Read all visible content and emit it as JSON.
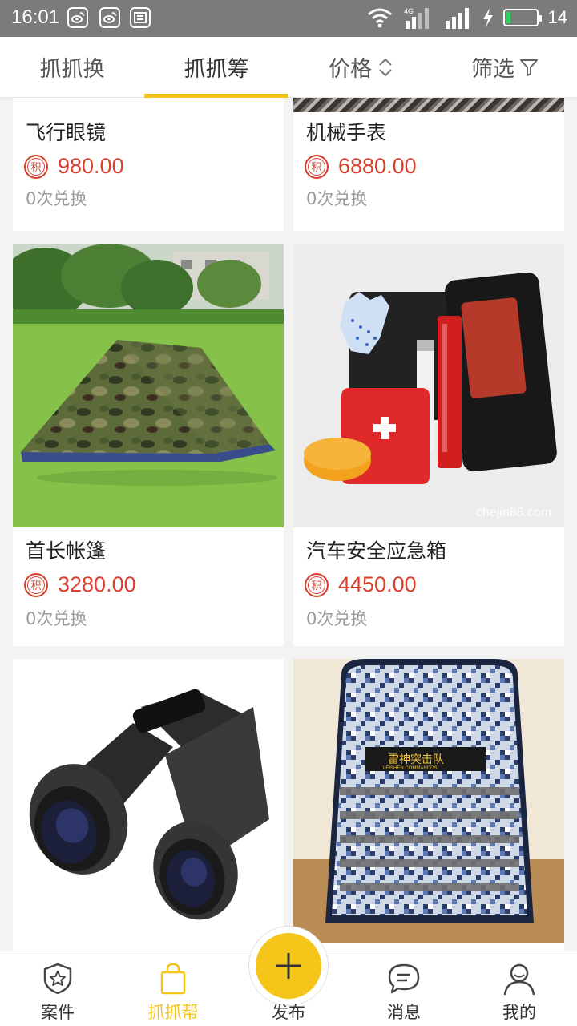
{
  "status_bar": {
    "time": "16:01",
    "network": "4G",
    "battery_percent": "14",
    "battery_level": 0.14
  },
  "tabs": [
    {
      "label": "抓抓换"
    },
    {
      "label": "抓抓筹"
    },
    {
      "label": "价格"
    },
    {
      "label": "筛选"
    }
  ],
  "products": [
    {
      "name": "飞行眼镜",
      "price": "980.00",
      "exchanges": "0次兑换",
      "badge": "积"
    },
    {
      "name": "机械手表",
      "price": "6880.00",
      "exchanges": "0次兑换",
      "badge": "积"
    },
    {
      "name": "首长帐篷",
      "price": "3280.00",
      "exchanges": "0次兑换",
      "badge": "积"
    },
    {
      "name": "汽车安全应急箱",
      "price": "4450.00",
      "exchanges": "0次兑换",
      "badge": "积",
      "watermark": "chejin88.com"
    },
    {
      "name": "",
      "price": "",
      "exchanges": ""
    },
    {
      "name": "",
      "price": "",
      "exchanges": "",
      "patch_text": "雷神突击队",
      "patch_sub": "LEISHEN COMMANDOS"
    }
  ],
  "bottom_nav": [
    {
      "label": "案件",
      "icon": "shield-star-icon"
    },
    {
      "label": "抓抓帮",
      "icon": "shopping-bag-icon"
    },
    {
      "label": "发布",
      "icon": "plus-icon"
    },
    {
      "label": "消息",
      "icon": "chat-bubble-icon"
    },
    {
      "label": "我的",
      "icon": "person-icon"
    }
  ],
  "colors": {
    "accent": "#f4c418",
    "price": "#d9402e",
    "status_bar": "#7b7b7b"
  }
}
